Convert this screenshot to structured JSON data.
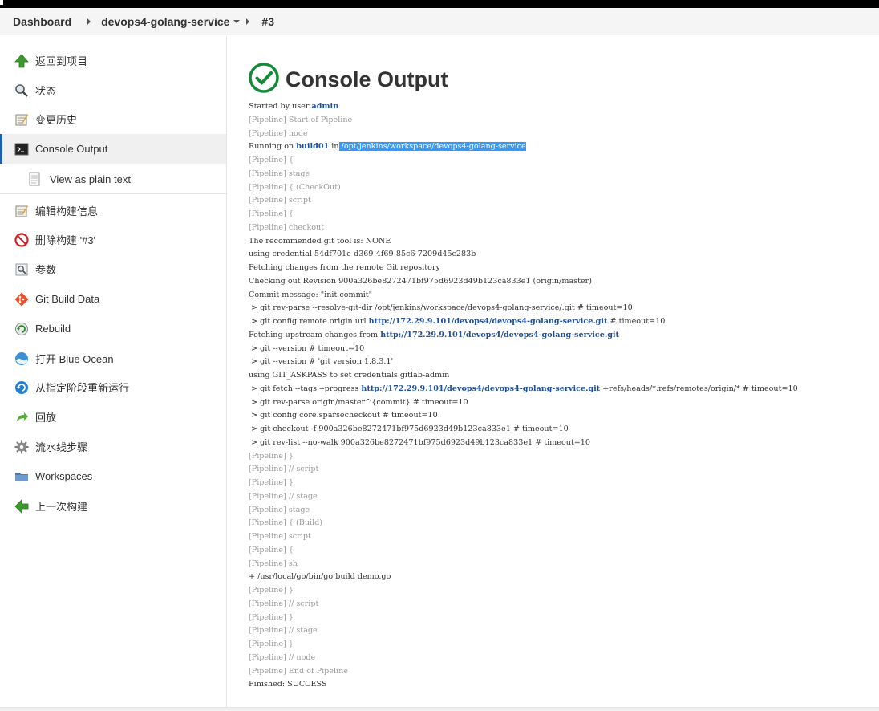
{
  "breadcrumb": {
    "dashboard": "Dashboard",
    "job": "devops4-golang-service",
    "build": "#3"
  },
  "sidebar": {
    "items": [
      {
        "label": "返回到项目",
        "icon": "up-arrow-icon"
      },
      {
        "label": "状态",
        "icon": "search-icon"
      },
      {
        "label": "变更历史",
        "icon": "notepad-icon"
      },
      {
        "label": "Console Output",
        "icon": "terminal-icon"
      },
      {
        "label": "View as plain text",
        "icon": "document-icon"
      },
      {
        "label": "编辑构建信息",
        "icon": "notepad-icon"
      },
      {
        "label": "删除构建 '#3'",
        "icon": "no-entry-icon"
      },
      {
        "label": "参数",
        "icon": "parameters-icon"
      },
      {
        "label": "Git Build Data",
        "icon": "git-icon"
      },
      {
        "label": "Rebuild",
        "icon": "rebuild-icon"
      },
      {
        "label": "打开 Blue Ocean",
        "icon": "blue-ocean-icon"
      },
      {
        "label": "从指定阶段重新运行",
        "icon": "restart-icon"
      },
      {
        "label": "回放",
        "icon": "replay-icon"
      },
      {
        "label": "流水线步骤",
        "icon": "gear-icon"
      },
      {
        "label": "Workspaces",
        "icon": "folder-icon"
      },
      {
        "label": "上一次构建",
        "icon": "left-arrow-icon"
      }
    ]
  },
  "main": {
    "title": "Console Output",
    "status_color": "#138a36"
  },
  "console": [
    [
      {
        "t": "Started by user "
      },
      {
        "t": "admin",
        "c": "lnk"
      }
    ],
    [
      {
        "t": "[Pipeline] Start of Pipeline",
        "c": "pl"
      }
    ],
    [
      {
        "t": "[Pipeline] node",
        "c": "pl"
      }
    ],
    [
      {
        "t": "Running on "
      },
      {
        "t": "build01",
        "c": "lnk"
      },
      {
        "t": " in"
      },
      {
        "t": " /opt/jenkins/workspace/devops4-golang-service",
        "c": "hl"
      }
    ],
    [
      {
        "t": "[Pipeline] {",
        "c": "pl"
      }
    ],
    [
      {
        "t": "[Pipeline] stage",
        "c": "pl"
      }
    ],
    [
      {
        "t": "[Pipeline] { (CheckOut)",
        "c": "pl"
      }
    ],
    [
      {
        "t": "[Pipeline] script",
        "c": "pl"
      }
    ],
    [
      {
        "t": "[Pipeline] {",
        "c": "pl"
      }
    ],
    [
      {
        "t": "[Pipeline] checkout",
        "c": "pl"
      }
    ],
    [
      {
        "t": "The recommended git tool is: NONE"
      }
    ],
    [
      {
        "t": "using credential 54df701e-d369-4f69-85c6-7209d45c283b"
      }
    ],
    [
      {
        "t": "Fetching changes from the remote Git repository"
      }
    ],
    [
      {
        "t": "Checking out Revision 900a326be8272471bf975d6923d49b123ca833e1 (origin/master)"
      }
    ],
    [
      {
        "t": "Commit message: \"init commit\""
      }
    ],
    [
      {
        "t": " > git rev-parse --resolve-git-dir /opt/jenkins/workspace/devops4-golang-service/.git # timeout=10"
      }
    ],
    [
      {
        "t": " > git config remote.origin.url "
      },
      {
        "t": "http://172.29.9.101/devops4/devops4-golang-service.git",
        "c": "lnk"
      },
      {
        "t": " # timeout=10"
      }
    ],
    [
      {
        "t": "Fetching upstream changes from "
      },
      {
        "t": "http://172.29.9.101/devops4/devops4-golang-service.git",
        "c": "lnk"
      }
    ],
    [
      {
        "t": " > git --version # timeout=10"
      }
    ],
    [
      {
        "t": " > git --version # 'git version 1.8.3.1'"
      }
    ],
    [
      {
        "t": "using GIT_ASKPASS to set credentials gitlab-admin"
      }
    ],
    [
      {
        "t": " > git fetch --tags --progress "
      },
      {
        "t": "http://172.29.9.101/devops4/devops4-golang-service.git",
        "c": "lnk"
      },
      {
        "t": " +refs/heads/*:refs/remotes/origin/* # timeout=10"
      }
    ],
    [
      {
        "t": " > git rev-parse origin/master^{commit} # timeout=10"
      }
    ],
    [
      {
        "t": " > git config core.sparsecheckout # timeout=10"
      }
    ],
    [
      {
        "t": " > git checkout -f 900a326be8272471bf975d6923d49b123ca833e1 # timeout=10"
      }
    ],
    [
      {
        "t": " > git rev-list --no-walk 900a326be8272471bf975d6923d49b123ca833e1 # timeout=10"
      }
    ],
    [
      {
        "t": "[Pipeline] }",
        "c": "pl"
      }
    ],
    [
      {
        "t": "[Pipeline] // script",
        "c": "pl"
      }
    ],
    [
      {
        "t": "[Pipeline] }",
        "c": "pl"
      }
    ],
    [
      {
        "t": "[Pipeline] // stage",
        "c": "pl"
      }
    ],
    [
      {
        "t": "[Pipeline] stage",
        "c": "pl"
      }
    ],
    [
      {
        "t": "[Pipeline] { (Build)",
        "c": "pl"
      }
    ],
    [
      {
        "t": "[Pipeline] script",
        "c": "pl"
      }
    ],
    [
      {
        "t": "[Pipeline] {",
        "c": "pl"
      }
    ],
    [
      {
        "t": "[Pipeline] sh",
        "c": "pl"
      }
    ],
    [
      {
        "t": "+ /usr/local/go/bin/go build demo.go"
      }
    ],
    [
      {
        "t": "[Pipeline] }",
        "c": "pl"
      }
    ],
    [
      {
        "t": "[Pipeline] // script",
        "c": "pl"
      }
    ],
    [
      {
        "t": "[Pipeline] }",
        "c": "pl"
      }
    ],
    [
      {
        "t": "[Pipeline] // stage",
        "c": "pl"
      }
    ],
    [
      {
        "t": "[Pipeline] }",
        "c": "pl"
      }
    ],
    [
      {
        "t": "[Pipeline] // node",
        "c": "pl"
      }
    ],
    [
      {
        "t": "[Pipeline] End of Pipeline",
        "c": "pl"
      }
    ],
    [
      {
        "t": "Finished: SUCCESS"
      }
    ]
  ]
}
